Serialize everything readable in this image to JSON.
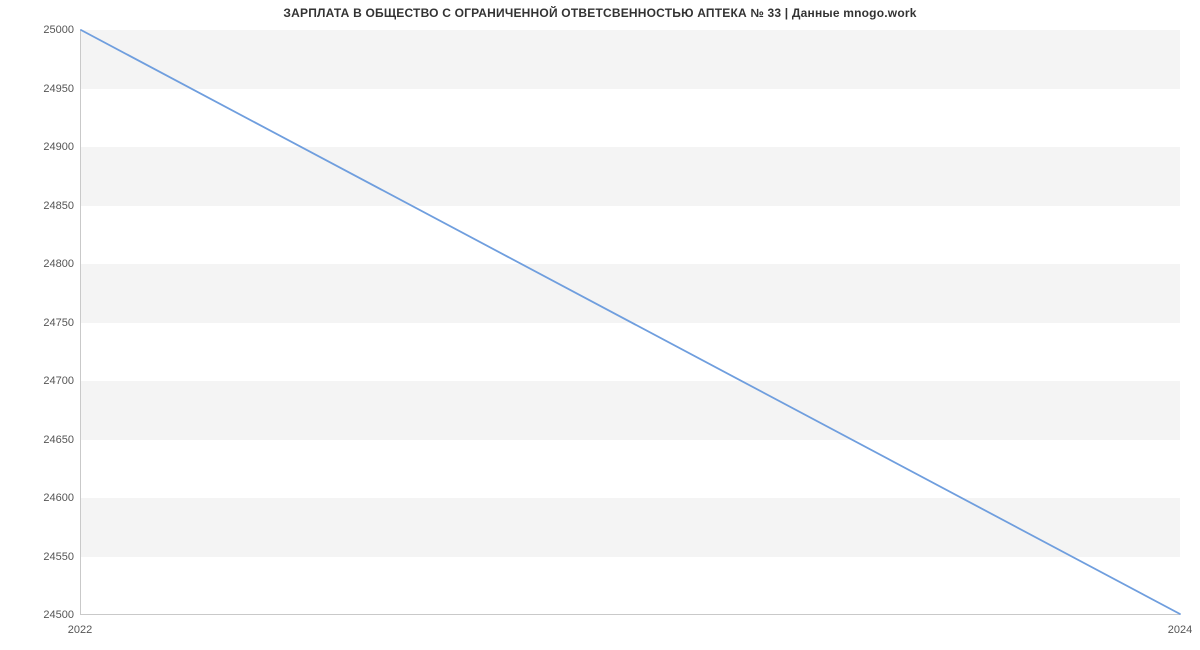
{
  "chart_data": {
    "type": "line",
    "title": "ЗАРПЛАТА В ОБЩЕСТВО С ОГРАНИЧЕННОЙ ОТВЕТСВЕННОСТЬЮ АПТЕКА № 33 | Данные mnogo.work",
    "xlabel": "",
    "ylabel": "",
    "x": [
      2022,
      2024
    ],
    "values": [
      25000,
      24500
    ],
    "xlim": [
      2022,
      2024
    ],
    "ylim": [
      24500,
      25000
    ],
    "y_ticks": [
      24500,
      24550,
      24600,
      24650,
      24700,
      24750,
      24800,
      24850,
      24900,
      24950,
      25000
    ],
    "x_ticks": [
      2022,
      2024
    ],
    "line_color": "#6f9ede",
    "band_color": "#f4f4f4",
    "grid": {
      "x": false,
      "y_bands": true
    }
  }
}
